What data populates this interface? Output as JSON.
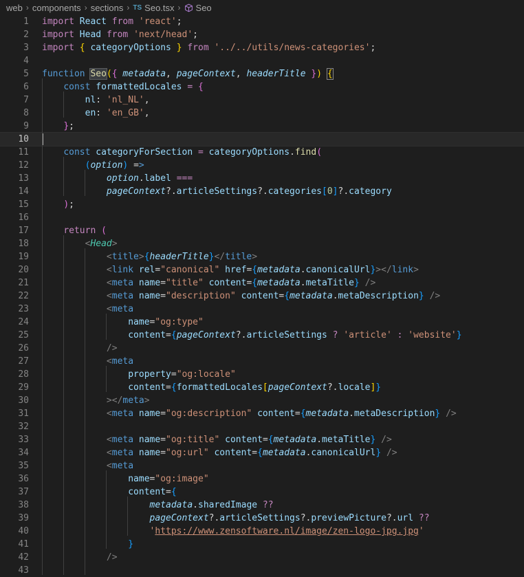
{
  "breadcrumb": {
    "segments": [
      "web",
      "components",
      "sections"
    ],
    "file": "Seo.tsx",
    "file_badge": "TS",
    "symbol": "Seo"
  },
  "editor": {
    "active_line": 10,
    "line_numbers": [
      "1",
      "2",
      "3",
      "4",
      "5",
      "6",
      "7",
      "8",
      "9",
      "10",
      "11",
      "12",
      "13",
      "14",
      "15",
      "16",
      "17",
      "18",
      "19",
      "20",
      "21",
      "22",
      "23",
      "24",
      "25",
      "26",
      "27",
      "28",
      "29",
      "30",
      "31",
      "32",
      "33",
      "34",
      "35",
      "36",
      "37",
      "38",
      "39",
      "40",
      "41",
      "42",
      "43"
    ],
    "lines": [
      "import React from 'react';",
      "import Head from 'next/head';",
      "import { categoryOptions } from '../../utils/news-categories';",
      "",
      "function Seo({ metadata, pageContext, headerTitle }) {",
      "    const formattedLocales = {",
      "        nl: 'nl_NL',",
      "        en: 'en_GB',",
      "    };",
      "",
      "    const categoryForSection = categoryOptions.find(",
      "        (option) =>",
      "            option.label ===",
      "            pageContext?.articleSettings?.categories[0]?.category",
      "    );",
      "",
      "    return (",
      "        <Head>",
      "            <title>{headerTitle}</title>",
      "            <link rel=\"canonical\" href={metadata.canonicalUrl}></link>",
      "            <meta name=\"title\" content={metadata.metaTitle} />",
      "            <meta name=\"description\" content={metadata.metaDescription} />",
      "            <meta",
      "                name=\"og:type\"",
      "                content={pageContext?.articleSettings ? 'article' : 'website'}",
      "            />",
      "            <meta",
      "                property=\"og:locale\"",
      "                content={formattedLocales[pageContext?.locale]}",
      "            ></meta>",
      "            <meta name=\"og:description\" content={metadata.metaDescription} />",
      "",
      "            <meta name=\"og:title\" content={metadata.metaTitle} />",
      "            <meta name=\"og:url\" content={metadata.canonicalUrl} />",
      "            <meta",
      "                name=\"og:image\"",
      "                content={",
      "                    metadata.sharedImage ??",
      "                    pageContext?.articleSettings?.previewPicture?.url ??",
      "                    'https://www.zensoftware.nl/image/zen-logo-jpg.jpg'",
      "                }",
      "            />",
      ""
    ]
  },
  "colors": {
    "background": "#1e1e1e",
    "keyword": "#569cd6",
    "control_keyword": "#c586c0",
    "string": "#ce9178",
    "function": "#dcdcaa",
    "variable": "#9cdcfe",
    "number": "#b5cea8",
    "line_number": "#858585"
  }
}
